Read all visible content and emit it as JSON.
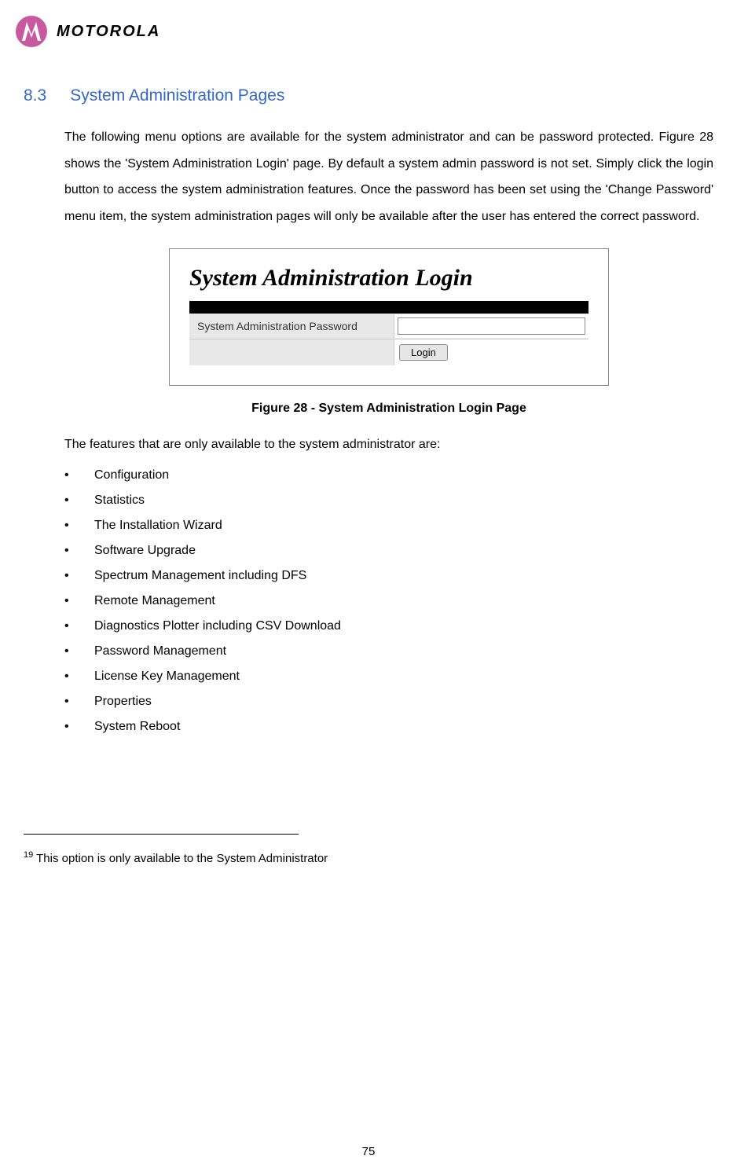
{
  "header": {
    "brand": "MOTOROLA"
  },
  "section": {
    "number": "8.3",
    "title": "System Administration Pages"
  },
  "paragraph1": "The following menu options are available for the system administrator and can be password protected. Figure 28 shows the 'System Administration Login' page. By default a system admin password is not set. Simply click the login button to access the system administration features. Once the password has been set using the 'Change Password' menu item, the system administration pages will only be available after the user has entered the correct password.",
  "figure": {
    "title": "System Administration Login",
    "password_label": "System Administration Password",
    "login_button": "Login",
    "caption": "Figure 28 - System Administration Login Page"
  },
  "features_intro": "The features that are only available to the system administrator are:",
  "features": [
    "Configuration",
    "Statistics",
    "The Installation Wizard",
    "Software Upgrade",
    "Spectrum Management including DFS",
    "Remote Management",
    "Diagnostics Plotter including CSV Download",
    "Password Management",
    "License Key Management",
    "Properties",
    "System Reboot"
  ],
  "footnote": {
    "number": "19",
    "text": " This option is only available to the System Administrator"
  },
  "page_number": "75"
}
